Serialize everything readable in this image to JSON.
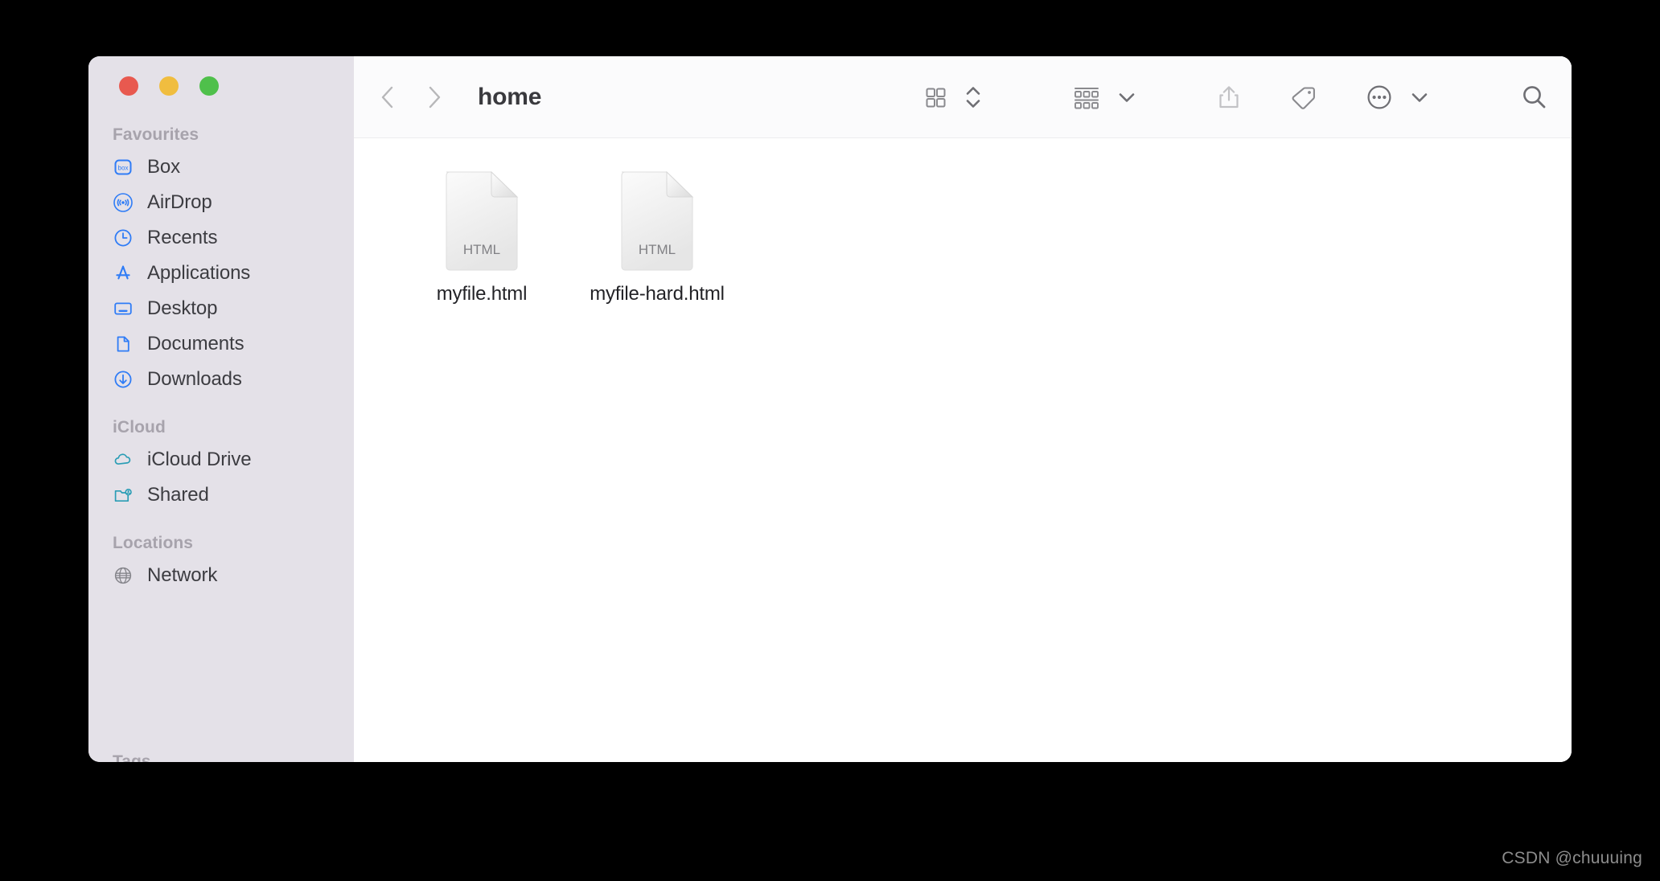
{
  "window": {
    "traffic_lights": [
      {
        "name": "close",
        "color": "#e8594f"
      },
      {
        "name": "minimize",
        "color": "#f0bd3f"
      },
      {
        "name": "maximize",
        "color": "#4fc04b"
      }
    ]
  },
  "sidebar": {
    "groups": [
      {
        "title": "Favourites",
        "items": [
          {
            "label": "Box",
            "icon": "box-logo-icon",
            "color": "#2f7cf6"
          },
          {
            "label": "AirDrop",
            "icon": "airdrop-icon",
            "color": "#2f7cf6"
          },
          {
            "label": "Recents",
            "icon": "clock-icon",
            "color": "#2f7cf6"
          },
          {
            "label": "Applications",
            "icon": "app-store-icon",
            "color": "#2f7cf6"
          },
          {
            "label": "Desktop",
            "icon": "desktop-monitor-icon",
            "color": "#2f7cf6"
          },
          {
            "label": "Documents",
            "icon": "document-page-icon",
            "color": "#2f7cf6"
          },
          {
            "label": "Downloads",
            "icon": "download-arrow-icon",
            "color": "#2f7cf6"
          }
        ]
      },
      {
        "title": "iCloud",
        "items": [
          {
            "label": "iCloud Drive",
            "icon": "cloud-icon",
            "color": "#2a9db5"
          },
          {
            "label": "Shared",
            "icon": "shared-folder-icon",
            "color": "#2a9db5"
          }
        ]
      },
      {
        "title": "Locations",
        "items": [
          {
            "label": "Network",
            "icon": "globe-icon",
            "color": "#84848a"
          }
        ]
      }
    ],
    "clipped_next_section": "Tags"
  },
  "toolbar": {
    "back_icon": "chevron-left-icon",
    "forward_icon": "chevron-right-icon",
    "title": "home",
    "buttons": [
      {
        "name": "icon-view-button",
        "icon": "grid-view-icon"
      },
      {
        "name": "view-options-stepper",
        "icon": "chevron-up-down-icon"
      },
      {
        "name": "group-by-button",
        "icon": "group-rows-icon"
      },
      {
        "name": "group-by-chevron",
        "icon": "chevron-down-icon"
      },
      {
        "name": "share-button",
        "icon": "share-up-arrow-icon"
      },
      {
        "name": "tags-button",
        "icon": "tag-icon"
      },
      {
        "name": "more-actions-button",
        "icon": "ellipsis-circle-icon"
      },
      {
        "name": "more-actions-chevron",
        "icon": "chevron-down-icon"
      },
      {
        "name": "search-button",
        "icon": "search-magnifier-icon"
      }
    ]
  },
  "content": {
    "files": [
      {
        "name": "myfile.html",
        "kind_label": "HTML",
        "icon": "html-document-icon"
      },
      {
        "name": "myfile-hard.html",
        "kind_label": "HTML",
        "icon": "html-document-icon"
      }
    ]
  },
  "watermark": {
    "text": "CSDN @chuuuing"
  }
}
